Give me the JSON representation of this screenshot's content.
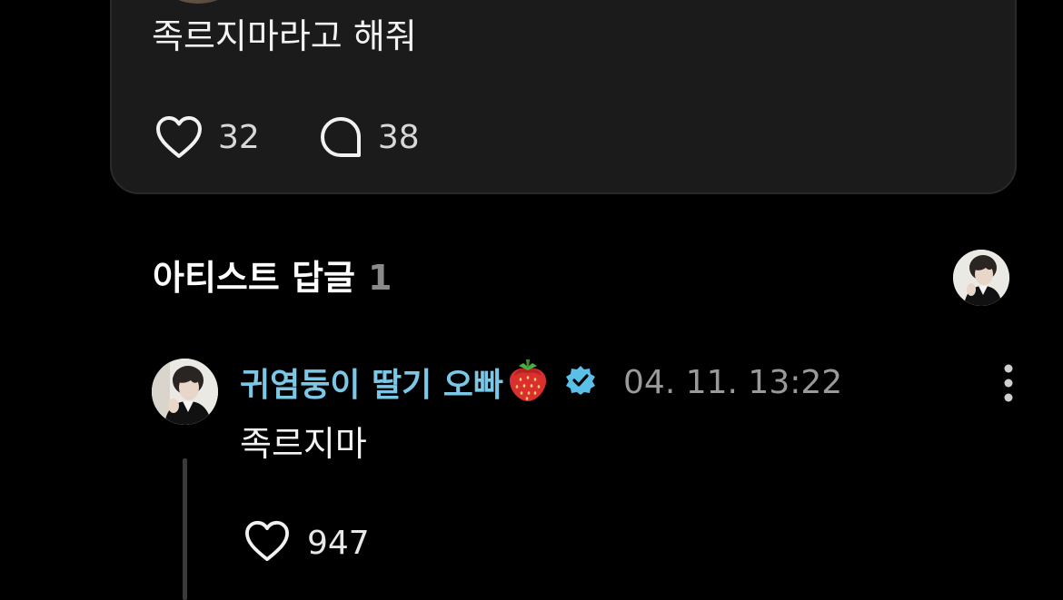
{
  "post": {
    "text": "족르지마라고 해줘",
    "like_count": "32",
    "comment_count": "38",
    "icons": {
      "like": "heart-icon",
      "comment": "comment-bubble-icon"
    }
  },
  "artist_replies": {
    "title": "아티스트 답글",
    "count": "1"
  },
  "reply": {
    "author": "귀염둥이 딸기 오빠",
    "emoji": "strawberry-icon",
    "verified": "verified-badge-icon",
    "timestamp": "04. 11. 13:22",
    "text": "족르지마",
    "like_count": "947"
  },
  "colors": {
    "background": "#000000",
    "card": "#1b1b1b",
    "author": "#7cc7e6",
    "verified": "#5bc0e8",
    "muted": "#9a9a9a"
  }
}
